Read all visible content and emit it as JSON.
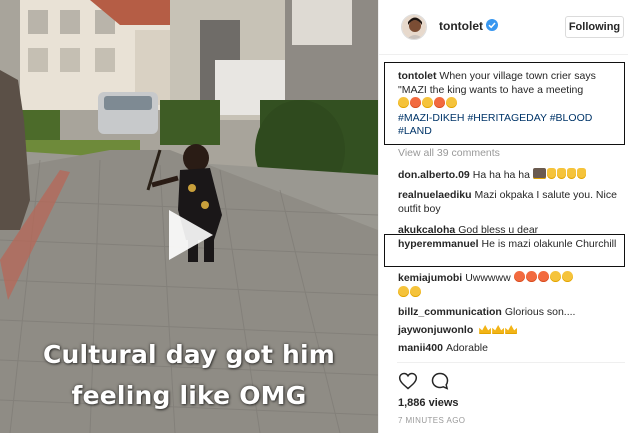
{
  "video": {
    "caption_line1": "Cultural day got him",
    "caption_line2": "feeling like OMG"
  },
  "header": {
    "username": "tontolet",
    "follow_label": "Following"
  },
  "caption": {
    "username": "tontolet",
    "text": "When your village town crier says \"MAZI the king wants to have a meeting",
    "hashtags": [
      "#MAZI-DIKEH",
      "#HERITAGEDAY",
      "#BLOOD",
      "#LAND"
    ]
  },
  "view_all": "View all 39 comments",
  "comments": [
    {
      "user": "don.alberto.09",
      "text": "Ha ha ha ha"
    },
    {
      "user": "realnuelaediku",
      "text": "Mazi okpaka I salute you. Nice outfit boy"
    },
    {
      "user": "akukcaloha",
      "text": "God bless u dear"
    },
    {
      "user": "hyperemmanuel",
      "text": "He is mazi olakunle Churchill"
    },
    {
      "user": "kemiajumobi",
      "text": "Uwwwww"
    },
    {
      "user": "billz_communication",
      "text": "Glorious son...."
    },
    {
      "user": "jaywonjuwonlo",
      "text": ""
    },
    {
      "user": "manii400",
      "text": "Adorable"
    }
  ],
  "stats": {
    "views": "1,886 views",
    "time": "7 MINUTES AGO"
  },
  "icons": [
    "play-icon",
    "verified-icon",
    "heart-icon",
    "comment-icon"
  ],
  "colors": {
    "accent": "#3897f0",
    "hashtag": "#003569",
    "muted": "#999999"
  }
}
